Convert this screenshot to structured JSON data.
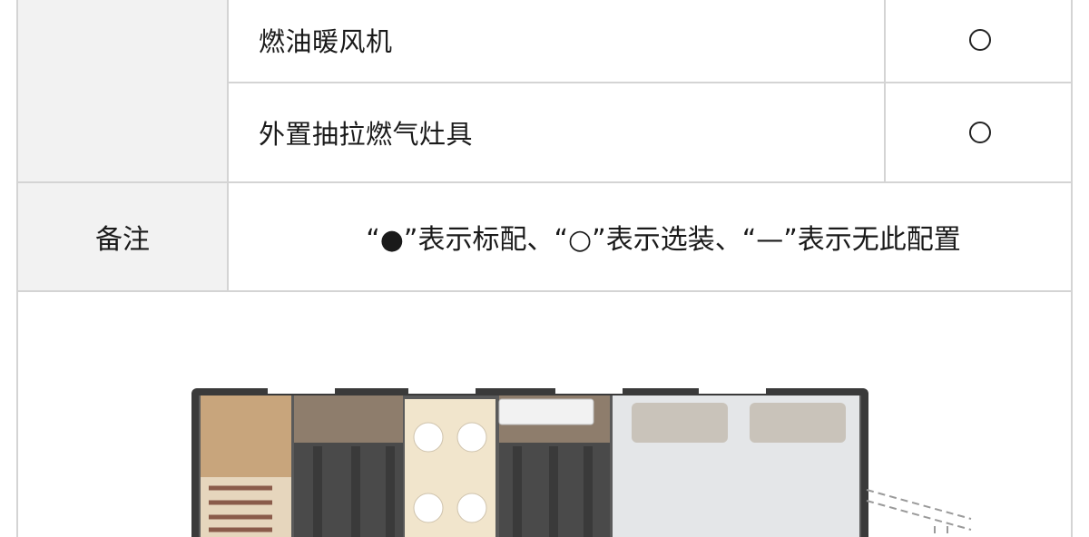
{
  "table": {
    "rows": [
      {
        "name": "燃油暖风机",
        "mark": "○"
      },
      {
        "name": "外置抽拉燃气灶具",
        "mark": "○"
      }
    ],
    "note": {
      "label": "备注",
      "text": "“●”表示标配、“○”表示选装、“—”表示无此配置"
    }
  },
  "floorplan": {
    "colors": {
      "wall": "#2b2b2b",
      "wood": "#c8a57c",
      "table_top": "#f1e5cc",
      "floor_dark": "#4a4a4a",
      "bed": "#e4e6e8",
      "pillow": "#c9c3ba",
      "ac_unit": "#f2f2f2"
    }
  }
}
